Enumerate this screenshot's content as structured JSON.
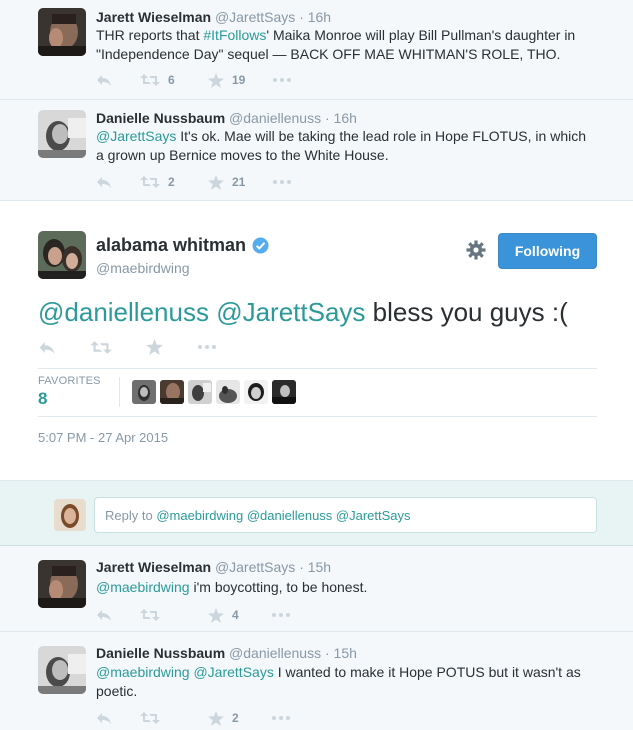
{
  "tweets_above": [
    {
      "name": "Jarett Wieselman",
      "handle": "@JarettSays",
      "time": "· 16h",
      "text_pre": "THR reports that ",
      "text_link": "#ItFollows",
      "text_post": "' Maika Monroe will play Bill Pullman's daughter in \"Independence Day\" sequel — BACK OFF MAE WHITMAN'S ROLE, THO.",
      "retweets": "6",
      "favorites": "19"
    },
    {
      "name": "Danielle Nussbaum",
      "handle": "@daniellenuss",
      "time": "· 16h",
      "text_link": "@JarettSays",
      "text_post": " It's ok. Mae will be taking the lead role in Hope FLOTUS, in which a grown up Bernice moves to the White House.",
      "retweets": "2",
      "favorites": "21"
    }
  ],
  "main_tweet": {
    "name": "alabama whitman",
    "handle": "@maebirdwing",
    "follow_label": "Following",
    "mention1": "@daniellenuss",
    "mention2": "@JarettSays",
    "text": " bless you guys :(",
    "favorites_label": "FAVORITES",
    "favorites_count": "8",
    "date": "5:07 PM - 27 Apr 2015"
  },
  "reply_box": {
    "prefix": "Reply to ",
    "mentions": "@maebirdwing @daniellenuss @JarettSays"
  },
  "replies": [
    {
      "name": "Jarett Wieselman",
      "handle": "@JarettSays",
      "time": "· 15h",
      "text_link": "@maebirdwing",
      "text_post": " i'm boycotting, to be honest.",
      "retweets": "",
      "favorites": "4"
    },
    {
      "name": "Danielle Nussbaum",
      "handle": "@daniellenuss",
      "time": "· 15h",
      "text_link": "@maebirdwing @JarettSays",
      "text_post": " I wanted to make it Hope POTUS but it wasn't as poetic.",
      "retweets": "",
      "favorites": "2"
    }
  ],
  "icons": {
    "reply": "reply-icon",
    "retweet": "retweet-icon",
    "favorite": "star-icon",
    "more": "more-icon",
    "settings": "gear-icon",
    "verified": "verified-badge-icon"
  },
  "colors": {
    "link": "#2c9a9a",
    "button": "#3b94d9",
    "muted": "#8899a6"
  }
}
